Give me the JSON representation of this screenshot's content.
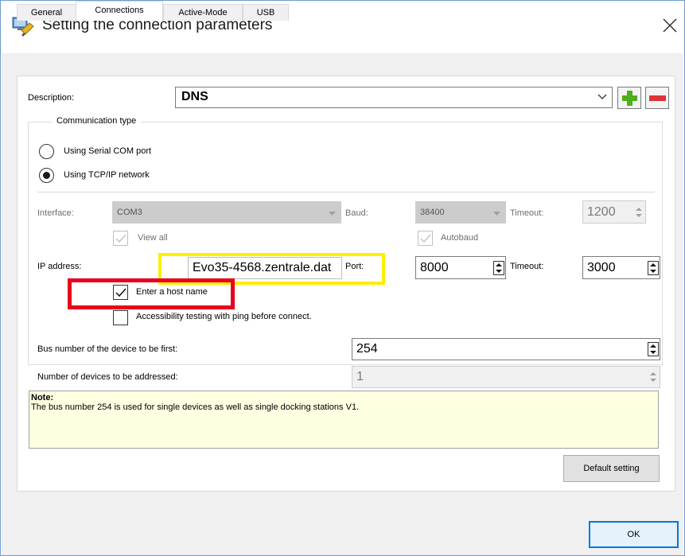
{
  "window": {
    "title": "Setting the connection parameters"
  },
  "tabs": [
    {
      "label": "General",
      "active": false
    },
    {
      "label": "Connections",
      "active": true
    },
    {
      "label": "Active-Mode",
      "active": false
    },
    {
      "label": "USB",
      "active": false
    }
  ],
  "description": {
    "label": "Description:",
    "value": "DNS"
  },
  "communication": {
    "group_label": "Communication type",
    "serial_label": "Using Serial COM port",
    "tcp_label": "Using TCP/IP network",
    "selected": "tcp"
  },
  "serial": {
    "interface_label": "Interface:",
    "interface_value": "COM3",
    "baud_label": "Baud:",
    "baud_value": "38400",
    "timeout_label": "Timeout:",
    "timeout_value": "1200",
    "view_all_label": "View all",
    "autobaud_label": "Autobaud"
  },
  "tcp": {
    "ip_label": "IP address:",
    "ip_value": "Evo35-4568.zentrale.dat",
    "port_label": "Port:",
    "port_value": "8000",
    "timeout_label": "Timeout:",
    "timeout_value": "3000",
    "hostname_label": "Enter a host name",
    "hostname_checked": true,
    "ping_label": "Accessibility testing with ping before connect.",
    "ping_checked": false
  },
  "bus": {
    "first_label": "Bus number of the device to be first:",
    "first_value": "254",
    "count_label": "Number of devices to be addressed:",
    "count_value": "1"
  },
  "note": {
    "title": "Note:",
    "text": "The bus number 254 is used for single devices as well as single docking stations V1."
  },
  "buttons": {
    "default_setting": "Default setting",
    "ok": "OK"
  },
  "colors": {
    "highlight_yellow": "#ffee00",
    "highlight_red": "#e8001c",
    "add": "#4caf1c",
    "remove": "#d9343a",
    "note_bg": "#ffffe1"
  }
}
